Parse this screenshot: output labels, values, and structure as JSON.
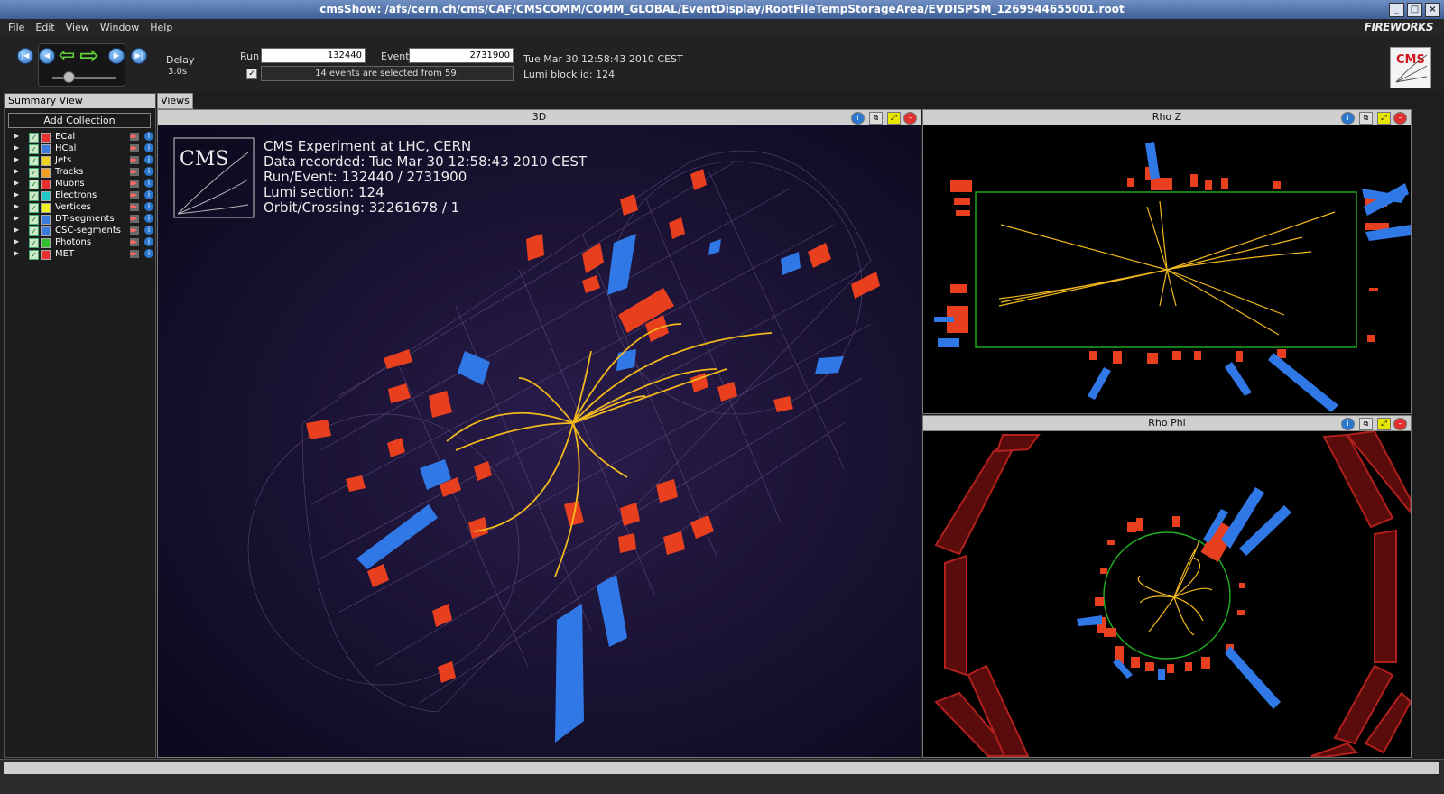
{
  "window": {
    "title": "cmsShow: /afs/cern.ch/cms/CAF/CMSCOMM/COMM_GLOBAL/EventDisplay/RootFileTempStorageArea/EVDISPSM_1269944655001.root",
    "controls": [
      "_",
      "□",
      "×"
    ]
  },
  "menu": [
    "File",
    "Edit",
    "View",
    "Window",
    "Help"
  ],
  "brand": {
    "fireworks": "FIREWORKS",
    "cms": "CMS"
  },
  "toolbar": {
    "delay_label": "Delay",
    "delay_value": "3.0s",
    "run_label": "Run",
    "run_value": "132440",
    "event_label": "Event",
    "event_value": "2731900",
    "filter_text": "14 events are selected from 59.",
    "filter_checked": true,
    "datetime": "Tue Mar 30 12:58:43 2010 CEST",
    "lumi_block": "Lumi block id: 124"
  },
  "summary": {
    "title": "Summary View",
    "add_button": "Add Collection",
    "collections": [
      {
        "name": "ECal",
        "color": "#e83030"
      },
      {
        "name": "HCal",
        "color": "#3a7bdc"
      },
      {
        "name": "Jets",
        "color": "#f0d020"
      },
      {
        "name": "Tracks",
        "color": "#f0a020"
      },
      {
        "name": "Muons",
        "color": "#e83030"
      },
      {
        "name": "Electrons",
        "color": "#20c8c8"
      },
      {
        "name": "Vertices",
        "color": "#f0f020"
      },
      {
        "name": "DT-segments",
        "color": "#3a7bdc"
      },
      {
        "name": "CSC-segments",
        "color": "#3a7bdc"
      },
      {
        "name": "Photons",
        "color": "#30c030"
      },
      {
        "name": "MET",
        "color": "#e83030"
      }
    ]
  },
  "views_tab": "Views",
  "views": {
    "v3d": "3D",
    "rhoz": "Rho Z",
    "rhophi": "Rho Phi"
  },
  "overlay": {
    "logo": "CMS",
    "line1": "CMS Experiment at LHC, CERN",
    "line2": "Data recorded: Tue Mar 30 12:58:43 2010 CEST",
    "line3": "Run/Event: 132440 / 2731900",
    "line4": "Lumi section: 124",
    "line5": "Orbit/Crossing: 32261678 / 1"
  },
  "colors": {
    "ecal": "#e8401f",
    "hcal": "#2f78e6",
    "tracks": "#f2b81c",
    "green": "#21b321"
  }
}
